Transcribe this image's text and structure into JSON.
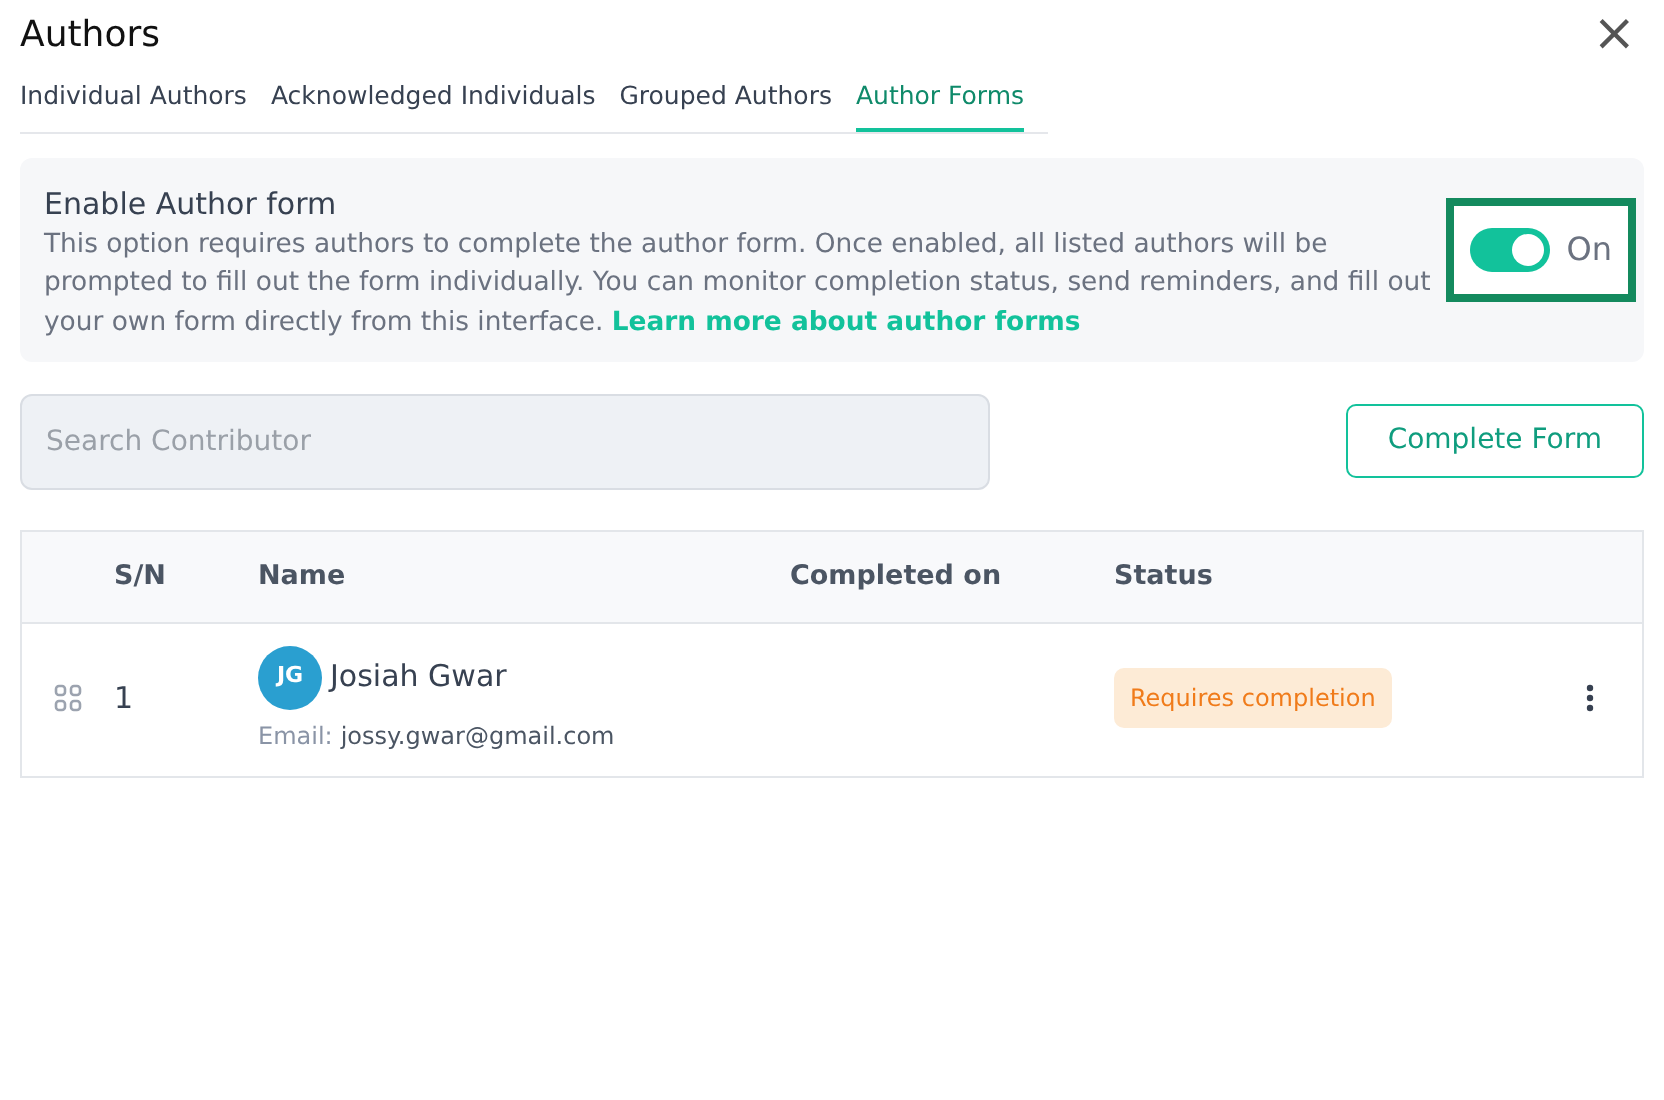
{
  "dialog": {
    "title": "Authors",
    "close": "×"
  },
  "tabs": [
    {
      "label": "Individual Authors",
      "selected": false
    },
    {
      "label": "Acknowledged Individuals",
      "selected": false
    },
    {
      "label": "Grouped Authors",
      "selected": false
    },
    {
      "label": "Author Forms",
      "selected": true
    }
  ],
  "setting": {
    "title": "Enable Author form",
    "description": "This option requires authors to complete the author form. Once enabled, all listed authors will be prompted to fill out the form individually. You can monitor completion status, send reminders, and fill out your own form directly from this interface.",
    "link": "Learn more about author forms",
    "on": true,
    "state_label": "On",
    "highlighted": true
  },
  "search": {
    "placeholder": "Search Contributor"
  },
  "complete_button": "Complete Form",
  "table": {
    "columns": [
      "S/N",
      "Name",
      "Completed on",
      "Status"
    ],
    "rows": [
      {
        "sn": "1",
        "initials": "JG",
        "color": "#2a9fd0",
        "name": "Josiah Gwar",
        "email_label": "Email:",
        "email": "jossy.gwar@gmail.com",
        "status": "Requires completion"
      }
    ]
  }
}
